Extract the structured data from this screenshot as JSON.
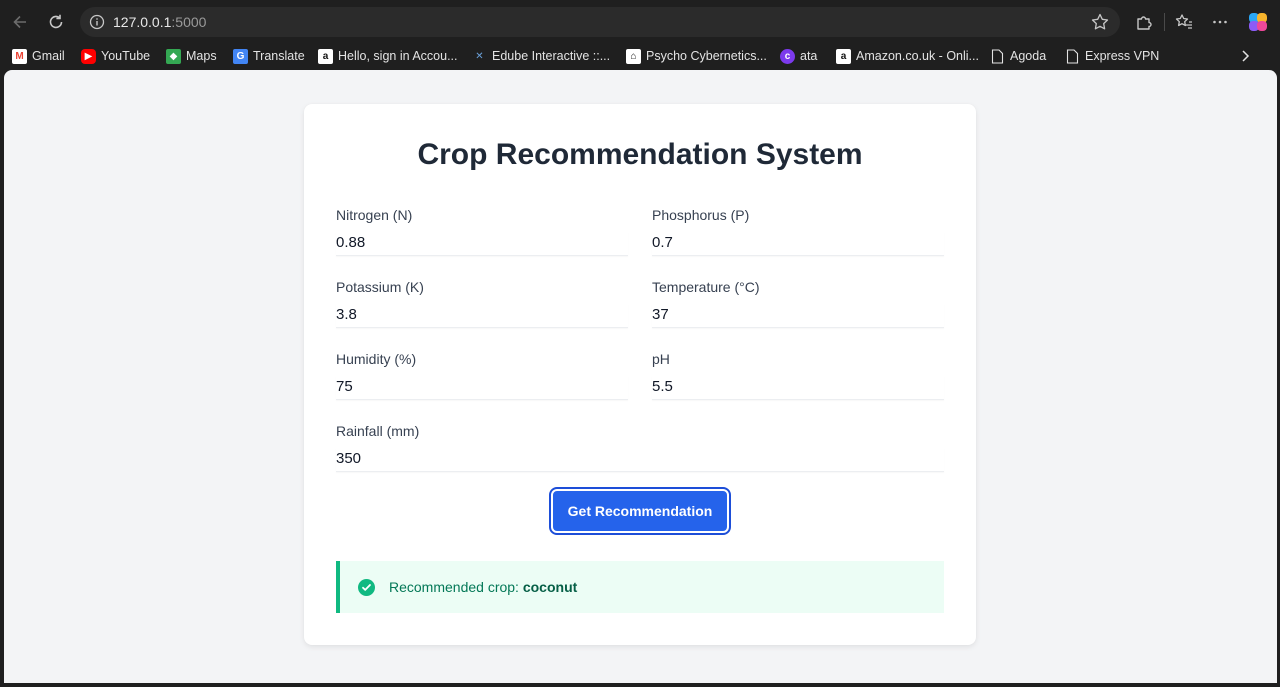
{
  "browser": {
    "url_host": "127.0.0.1",
    "url_port": ":5000",
    "bookmarks": [
      {
        "label": "Gmail",
        "icon": "gmail-icon"
      },
      {
        "label": "YouTube",
        "icon": "youtube-icon"
      },
      {
        "label": "Maps",
        "icon": "maps-icon"
      },
      {
        "label": "Translate",
        "icon": "translate-icon"
      },
      {
        "label": "Hello, sign in Accou...",
        "icon": "amazon-icon"
      },
      {
        "label": "Edube Interactive ::...",
        "icon": "edube-icon"
      },
      {
        "label": "Psycho Cybernetics...",
        "icon": "library-icon"
      },
      {
        "label": "ata",
        "icon": "ata-icon"
      },
      {
        "label": "Amazon.co.uk - Onli...",
        "icon": "amazon-icon"
      },
      {
        "label": "Agoda",
        "icon": "page-icon"
      },
      {
        "label": "Express VPN",
        "icon": "page-icon"
      }
    ]
  },
  "form": {
    "title": "Crop Recommendation System",
    "fields": [
      {
        "label": "Nitrogen (N)",
        "value": "0.88"
      },
      {
        "label": "Phosphorus (P)",
        "value": "0.7"
      },
      {
        "label": "Potassium (K)",
        "value": "3.8"
      },
      {
        "label": "Temperature (°C)",
        "value": "37"
      },
      {
        "label": "Humidity (%)",
        "value": "75"
      },
      {
        "label": "pH",
        "value": "5.5"
      },
      {
        "label": "Rainfall (mm)",
        "value": "350"
      }
    ],
    "submit_label": "Get Recommendation"
  },
  "result": {
    "prefix": "Recommended crop:",
    "crop": "coconut"
  },
  "colors": {
    "accent": "#2563eb",
    "success": "#10b981",
    "success_bg": "#ecfdf5"
  }
}
